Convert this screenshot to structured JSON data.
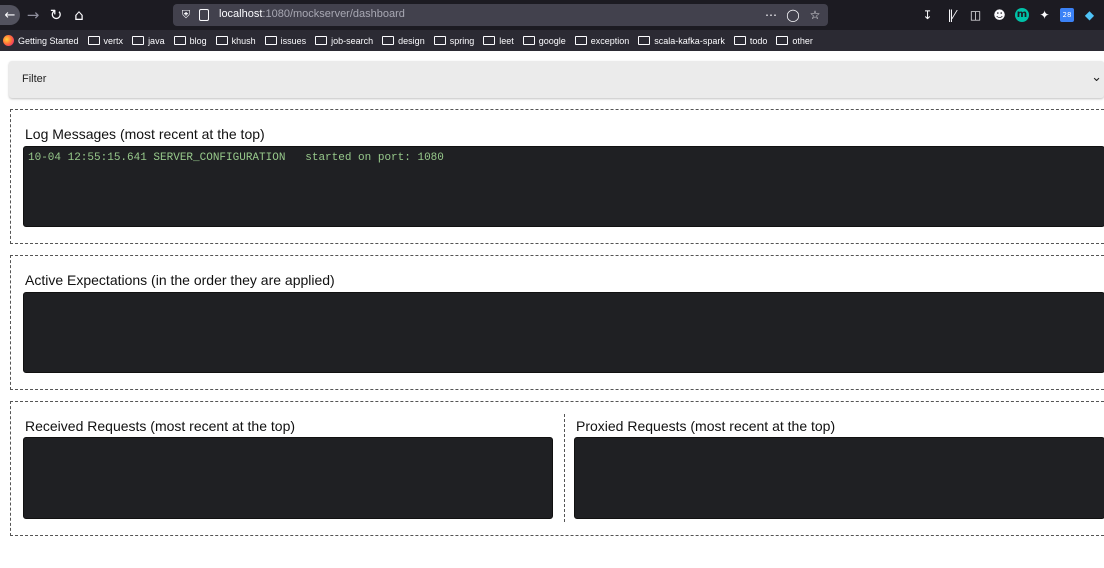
{
  "browser": {
    "url_host": "localhost",
    "url_path": ":1080/mockserver/dashboard",
    "nav_icons": [
      "back-icon",
      "forward-icon",
      "reload-icon",
      "home-icon"
    ],
    "url_action_icons": [
      "more-icon",
      "pocket-icon",
      "bookmark-star-icon"
    ],
    "toolbar_icons": [
      "download-icon",
      "library-icon",
      "sidebar-icon",
      "account-icon",
      "extension-m-icon",
      "extension-icon",
      "calendar-extension-icon",
      "gem-extension-icon"
    ],
    "extension_m_label": "m",
    "calendar_label": "28"
  },
  "bookmarks": [
    {
      "label": "Getting Started",
      "icon": "firefox-icon"
    },
    {
      "label": "vertx",
      "icon": "folder-icon"
    },
    {
      "label": "java",
      "icon": "folder-icon"
    },
    {
      "label": "blog",
      "icon": "folder-icon"
    },
    {
      "label": "khush",
      "icon": "folder-icon"
    },
    {
      "label": "issues",
      "icon": "folder-icon"
    },
    {
      "label": "job-search",
      "icon": "folder-icon"
    },
    {
      "label": "design",
      "icon": "folder-icon"
    },
    {
      "label": "spring",
      "icon": "folder-icon"
    },
    {
      "label": "leet",
      "icon": "folder-icon"
    },
    {
      "label": "google",
      "icon": "folder-icon"
    },
    {
      "label": "exception",
      "icon": "folder-icon"
    },
    {
      "label": "scala-kafka-spark",
      "icon": "folder-icon"
    },
    {
      "label": "todo",
      "icon": "folder-icon"
    },
    {
      "label": "other",
      "icon": "folder-icon"
    }
  ],
  "filter": {
    "label": "Filter",
    "expanded": false
  },
  "log_messages": {
    "title": "Log Messages (most recent at the top)",
    "lines": [
      "10-04 12:55:15.641 SERVER_CONFIGURATION   started on port: 1080"
    ]
  },
  "active_expectations": {
    "title": "Active Expectations (in the order they are applied)"
  },
  "received_requests": {
    "title": "Received Requests (most recent at the top)"
  },
  "proxied_requests": {
    "title": "Proxied Requests (most recent at the top)"
  },
  "colors": {
    "log_text": "#97c98b",
    "console_bg": "#1f2023",
    "toolbar_bg": "#1c1b22"
  }
}
